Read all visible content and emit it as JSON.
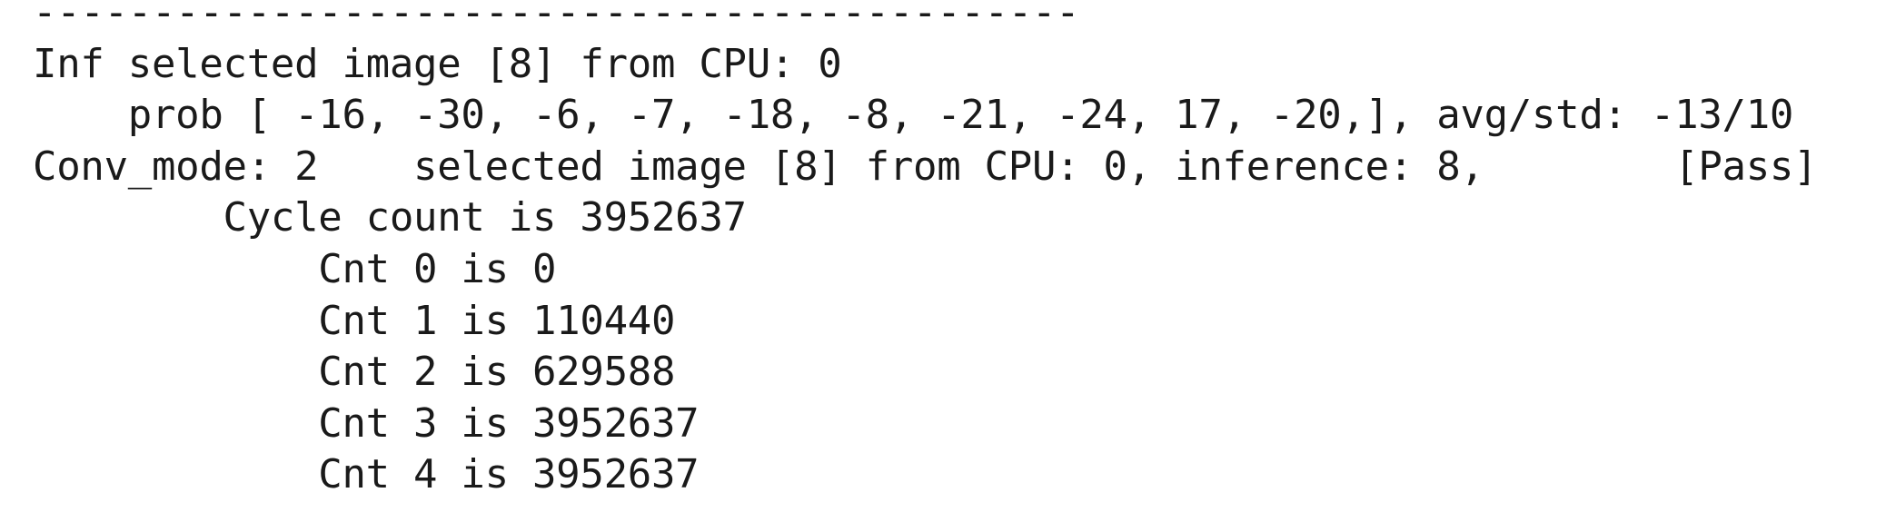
{
  "console": {
    "lines": [
      "--------------------------------------------",
      "Inf selected image [8] from CPU: 0",
      "    prob [ -16, -30, -6, -7, -18, -8, -21, -24, 17, -20,], avg/std: -13/10",
      "Conv_mode: 2    selected image [8] from CPU: 0, inference: 8,        [Pass]",
      "        Cycle count is 3952637",
      "            Cnt 0 is 0",
      "            Cnt 1 is 110440",
      "            Cnt 2 is 629588",
      "            Cnt 3 is 3952637",
      "            Cnt 4 is 3952637"
    ]
  }
}
